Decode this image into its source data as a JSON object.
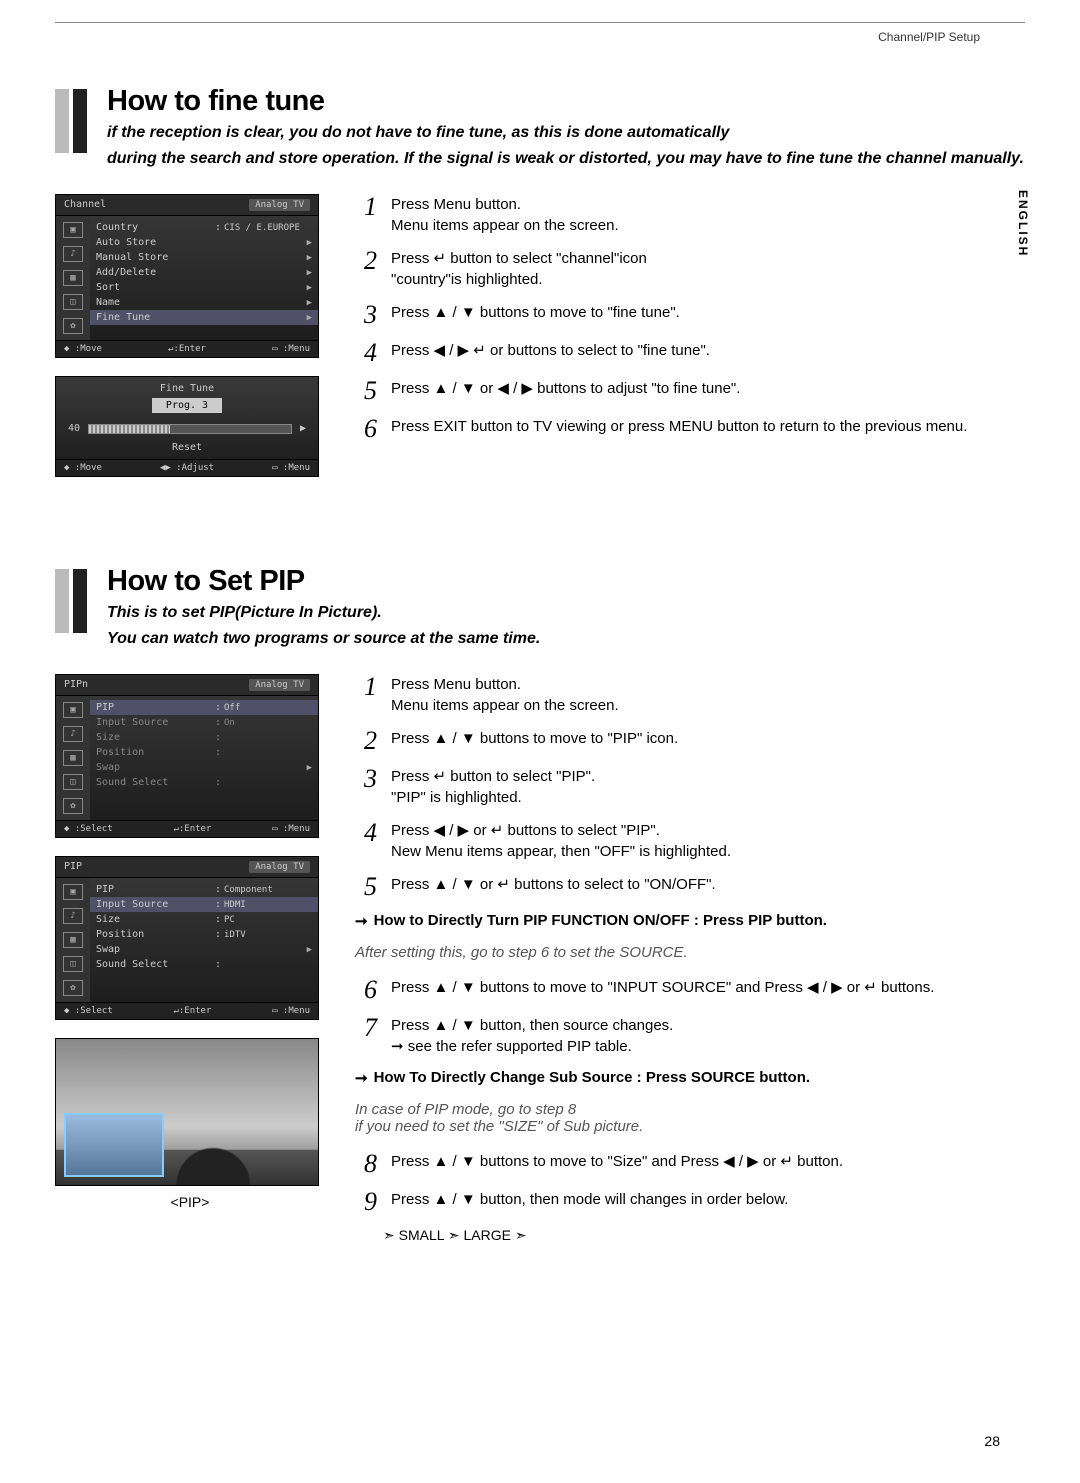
{
  "header": {
    "section_label": "Channel/PIP Setup",
    "language": "ENGLISH",
    "page_num": "28"
  },
  "section1": {
    "title": "How to fine tune",
    "intro1": "if  the reception is clear, you do not have to fine tune, as this is done  automatically",
    "intro2": "during the search and store operation. If the signal is weak or distorted, you may  have to  fine tune the channel manually.",
    "osd1": {
      "title": "Channel",
      "mode": "Analog TV",
      "rows": [
        {
          "label": "Country",
          "colon": ":",
          "val": "CIS / E.EUROPE"
        },
        {
          "label": "Auto Store",
          "arrow": "▶"
        },
        {
          "label": "Manual Store",
          "arrow": "▶"
        },
        {
          "label": "Add/Delete",
          "arrow": "▶"
        },
        {
          "label": "Sort",
          "arrow": "▶"
        },
        {
          "label": "Name",
          "arrow": "▶"
        },
        {
          "label": "Fine Tune",
          "arrow": "▶",
          "hl": true
        }
      ],
      "foot": {
        "a": "◆ :Move",
        "b": "↵:Enter",
        "c": "▭ :Menu"
      }
    },
    "osd2": {
      "title": "Fine Tune",
      "prog": "Prog. 3",
      "value": "40",
      "reset": "Reset",
      "foot": {
        "a": "◆ :Move",
        "b": "◀▶ :Adjust",
        "c": "▭ :Menu"
      }
    },
    "steps": [
      {
        "n": "1",
        "t": "Press Menu button.\nMenu items appear on the screen."
      },
      {
        "n": "2",
        "t": "Press  ↵  button to select \"channel\"icon\n\"country\"is  highlighted."
      },
      {
        "n": "3",
        "t": "Press  ▲ / ▼  buttons to move to \"fine tune\"."
      },
      {
        "n": "4",
        "t": "Press  ◀ / ▶  ↵  or  buttons to select to \"fine tune\"."
      },
      {
        "n": "5",
        "t": "Press  ▲ / ▼ or ◀ / ▶  buttons to adjust \"to fine tune\"."
      },
      {
        "n": "6",
        "t": "Press EXIT button to TV viewing or press MENU button to return to the previous menu."
      }
    ]
  },
  "section2": {
    "title": "How to Set PIP",
    "intro1": "This is to set PIP(Picture In Picture).",
    "intro2": "You can watch two programs or source at the same time.",
    "osd1": {
      "title": "PIPn",
      "mode": "Analog TV",
      "rows": [
        {
          "label": "PIP",
          "colon": ":",
          "val": "Off",
          "hl": true
        },
        {
          "label": "Input Source",
          "colon": ":",
          "val": "On",
          "muted": true
        },
        {
          "label": "Size",
          "colon": ":",
          "muted": true
        },
        {
          "label": "Position",
          "colon": ":",
          "muted": true
        },
        {
          "label": "Swap",
          "arrow": "▶",
          "muted": true
        },
        {
          "label": "Sound Select",
          "colon": ":",
          "muted": true
        }
      ],
      "foot": {
        "a": "◆ :Select",
        "b": "↵:Enter",
        "c": "▭ :Menu"
      }
    },
    "osd2": {
      "title": "PIP",
      "mode": "Analog TV",
      "rows": [
        {
          "label": "PIP",
          "colon": ":",
          "val": "Component"
        },
        {
          "label": "Input Source",
          "colon": ":",
          "val": "HDMI",
          "hl": true
        },
        {
          "label": "Size",
          "colon": ":",
          "val": "PC"
        },
        {
          "label": "Position",
          "colon": ":",
          "val": "iDTV"
        },
        {
          "label": "Swap",
          "arrow": "▶"
        },
        {
          "label": "Sound Select",
          "colon": ":"
        }
      ],
      "foot": {
        "a": "◆ :Select",
        "b": "↵:Enter",
        "c": "▭ :Menu"
      }
    },
    "pip_label": "<PIP>",
    "steps_a": [
      {
        "n": "1",
        "t": "Press Menu button.\nMenu items appear on the screen."
      },
      {
        "n": "2",
        "t": "Press  ▲ / ▼ buttons to move to \"PIP\" icon."
      },
      {
        "n": "3",
        "t": "Press ↵ button to select \"PIP\".\n\"PIP\" is highlighted."
      },
      {
        "n": "4",
        "t": "Press  ◀ / ▶  or ↵ buttons to select \"PIP\".\nNew Menu items appear, then \"OFF\" is highlighted."
      },
      {
        "n": "5",
        "t": "Press  ▲ / ▼ or ↵  buttons to select to \"ON/OFF\"."
      }
    ],
    "note1": "How to Directly Turn PIP FUNCTION ON/OFF : Press PIP button.",
    "note_after": "After setting this, go to step 6 to set the SOURCE.",
    "steps_b": [
      {
        "n": "6",
        "t": "Press  ▲ / ▼ buttons to move to \"INPUT SOURCE\" and Press  ◀ / ▶   or  ↵ buttons."
      },
      {
        "n": "7",
        "t": "Press  ▲ / ▼ button, then source changes.\n  ➞  see the refer supported PIP table."
      }
    ],
    "note2": "How To Directly Change Sub Source : Press SOURCE button.",
    "note_case": "In case of PIP mode, go to step 8\nif you need to set the \"SIZE\" of Sub picture.",
    "steps_c": [
      {
        "n": "8",
        "t": "Press ▲ / ▼ buttons to move to \"Size\" and Press   ◀ / ▶   or  ↵  button."
      },
      {
        "n": "9",
        "t": "Press  ▲ / ▼ button, then mode will changes in order below."
      }
    ],
    "modes": "➣ SMALL ➣ LARGE ➣"
  }
}
